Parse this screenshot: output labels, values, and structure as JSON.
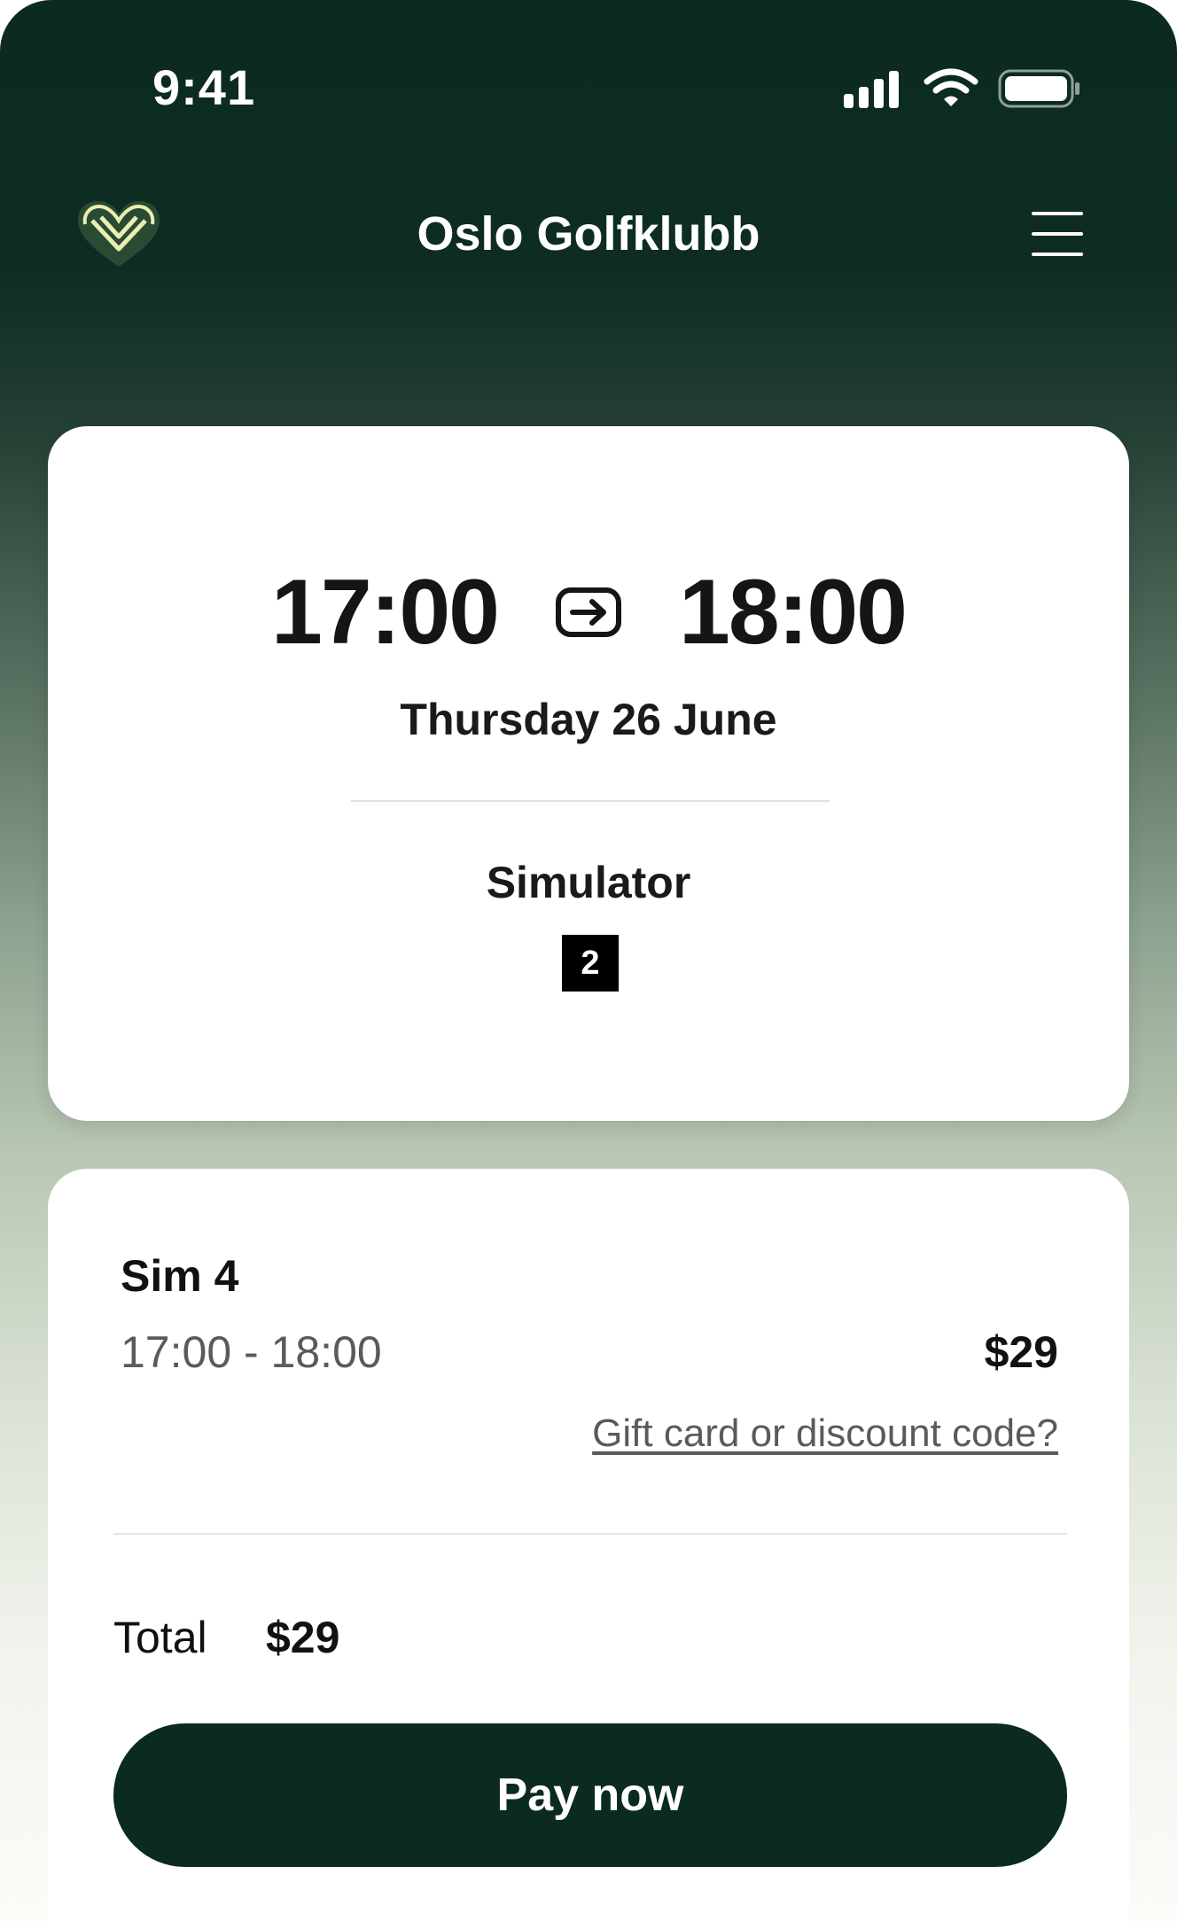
{
  "status_bar": {
    "time": "9:41",
    "icons": [
      "signal-icon",
      "wifi-icon",
      "battery-icon"
    ]
  },
  "header": {
    "title": "Oslo Golfklubb",
    "logo_icon": "heart-logo-icon",
    "menu_icon": "hamburger-menu-icon"
  },
  "booking": {
    "start_time": "17:00",
    "end_time": "18:00",
    "date": "Thursday 26 June",
    "resource_type": "Simulator",
    "resource_number": "2"
  },
  "summary": {
    "item_name": "Sim 4",
    "item_time": "17:00 - 18:00",
    "item_price": "$29",
    "discount_link": "Gift card or discount code?",
    "total_label": "Total",
    "total_value": "$29",
    "pay_button": "Pay now"
  },
  "colors": {
    "brand_dark": "#0b2a20",
    "logo_accent": "#e9efb0",
    "text_primary": "#151515",
    "text_muted": "#5a5a5a"
  }
}
